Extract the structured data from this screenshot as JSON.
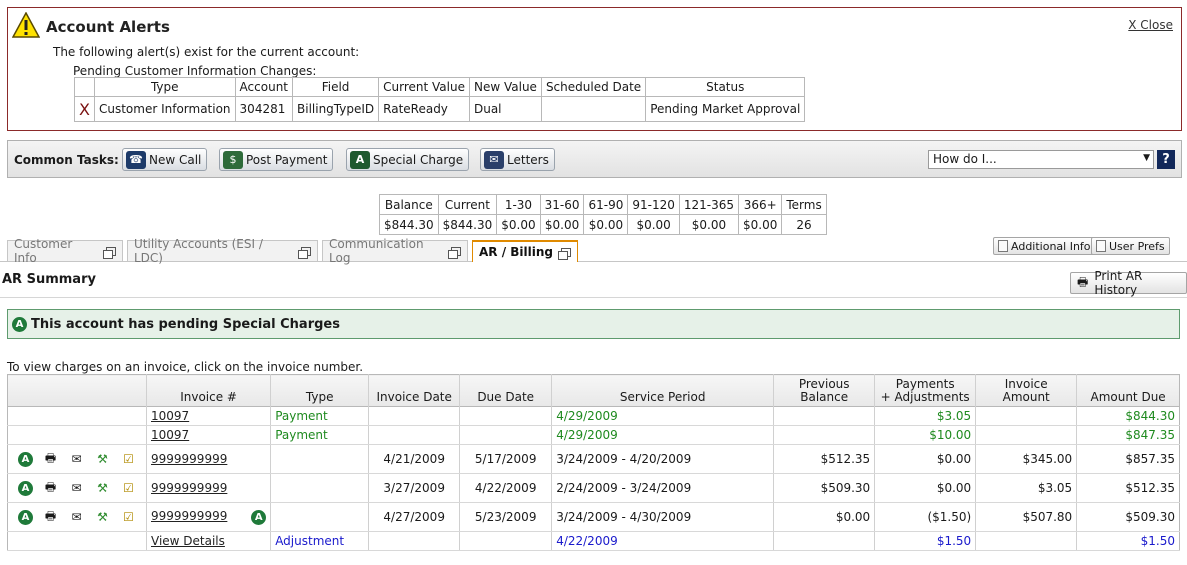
{
  "alert": {
    "title": "Account Alerts",
    "close_label": "X Close",
    "intro": "The following alert(s) exist for the current account:",
    "subheading": "Pending Customer Information Changes:",
    "columns": [
      "Type",
      "Account",
      "Field",
      "Current Value",
      "New Value",
      "Scheduled Date",
      "Status"
    ],
    "rows": [
      {
        "mark": "X",
        "type": "Customer Information",
        "account": "304281",
        "field": "BillingTypeID",
        "current": "RateReady",
        "new": "Dual",
        "scheduled": "",
        "status": "Pending Market Approval"
      }
    ]
  },
  "toolbar": {
    "label": "Common Tasks:",
    "new_call": "New Call",
    "post_payment": "Post Payment",
    "special_charge": "Special Charge",
    "letters": "Letters",
    "howdo_value": "How do I...",
    "help_label": "?"
  },
  "balance": {
    "headers": [
      "Balance",
      "Current",
      "1-30",
      "31-60",
      "61-90",
      "91-120",
      "121-365",
      "366+",
      "Terms"
    ],
    "values": [
      "$844.30",
      "$844.30",
      "$0.00",
      "$0.00",
      "$0.00",
      "$0.00",
      "$0.00",
      "$0.00",
      "26"
    ]
  },
  "tabs": [
    {
      "label": "Customer Info"
    },
    {
      "label": "Utility Accounts (ESI / LDC)"
    },
    {
      "label": "Communication Log"
    },
    {
      "label": "AR / Billing"
    }
  ],
  "buttons": {
    "additional_info": "Additional Info",
    "user_prefs": "User Prefs",
    "print_ar": "Print AR History"
  },
  "ar": {
    "title": "AR Summary",
    "notice": "This account has pending Special Charges",
    "hint": "To view charges on an invoice, click on the invoice number.",
    "badge": "A",
    "columns": {
      "invoice": "Invoice #",
      "type": "Type",
      "invoice_date": "Invoice Date",
      "due_date": "Due Date",
      "service_period": "Service Period",
      "prev_balance_1": "Previous",
      "prev_balance_2": "Balance",
      "payments_1": "Payments",
      "payments_2": "+ Adjustments",
      "inv_amount_1": "Invoice",
      "inv_amount_2": "Amount",
      "amount_due": "Amount Due"
    },
    "rows": [
      {
        "invoice": "10097",
        "type": "Payment",
        "invoice_date": "",
        "due_date": "",
        "service_period": "4/29/2009",
        "prev": "",
        "payments": "$3.05",
        "inv_amount": "",
        "amount_due": "$844.30"
      },
      {
        "invoice": "10097",
        "type": "Payment",
        "invoice_date": "",
        "due_date": "",
        "service_period": "4/29/2009",
        "prev": "",
        "payments": "$10.00",
        "inv_amount": "",
        "amount_due": "$847.35"
      },
      {
        "invoice": "9999999999",
        "type": "",
        "invoice_date": "4/21/2009",
        "due_date": "5/17/2009",
        "service_period": "3/24/2009 - 4/20/2009",
        "prev": "$512.35",
        "payments": "$0.00",
        "inv_amount": "$345.00",
        "amount_due": "$857.35"
      },
      {
        "invoice": "9999999999",
        "type": "",
        "invoice_date": "3/27/2009",
        "due_date": "4/22/2009",
        "service_period": "2/24/2009 - 3/24/2009",
        "prev": "$509.30",
        "payments": "$0.00",
        "inv_amount": "$3.05",
        "amount_due": "$512.35"
      },
      {
        "invoice": "9999999999",
        "type": "",
        "invoice_date": "4/27/2009",
        "due_date": "5/23/2009",
        "service_period": "3/24/2009 - 4/30/2009",
        "prev": "$0.00",
        "payments": "($1.50)",
        "inv_amount": "$507.80",
        "amount_due": "$509.30"
      },
      {
        "invoice": "View Details",
        "type": "Adjustment",
        "invoice_date": "",
        "due_date": "",
        "service_period": "4/22/2009",
        "prev": "",
        "payments": "$1.50",
        "inv_amount": "",
        "amount_due": "$1.50"
      }
    ]
  }
}
